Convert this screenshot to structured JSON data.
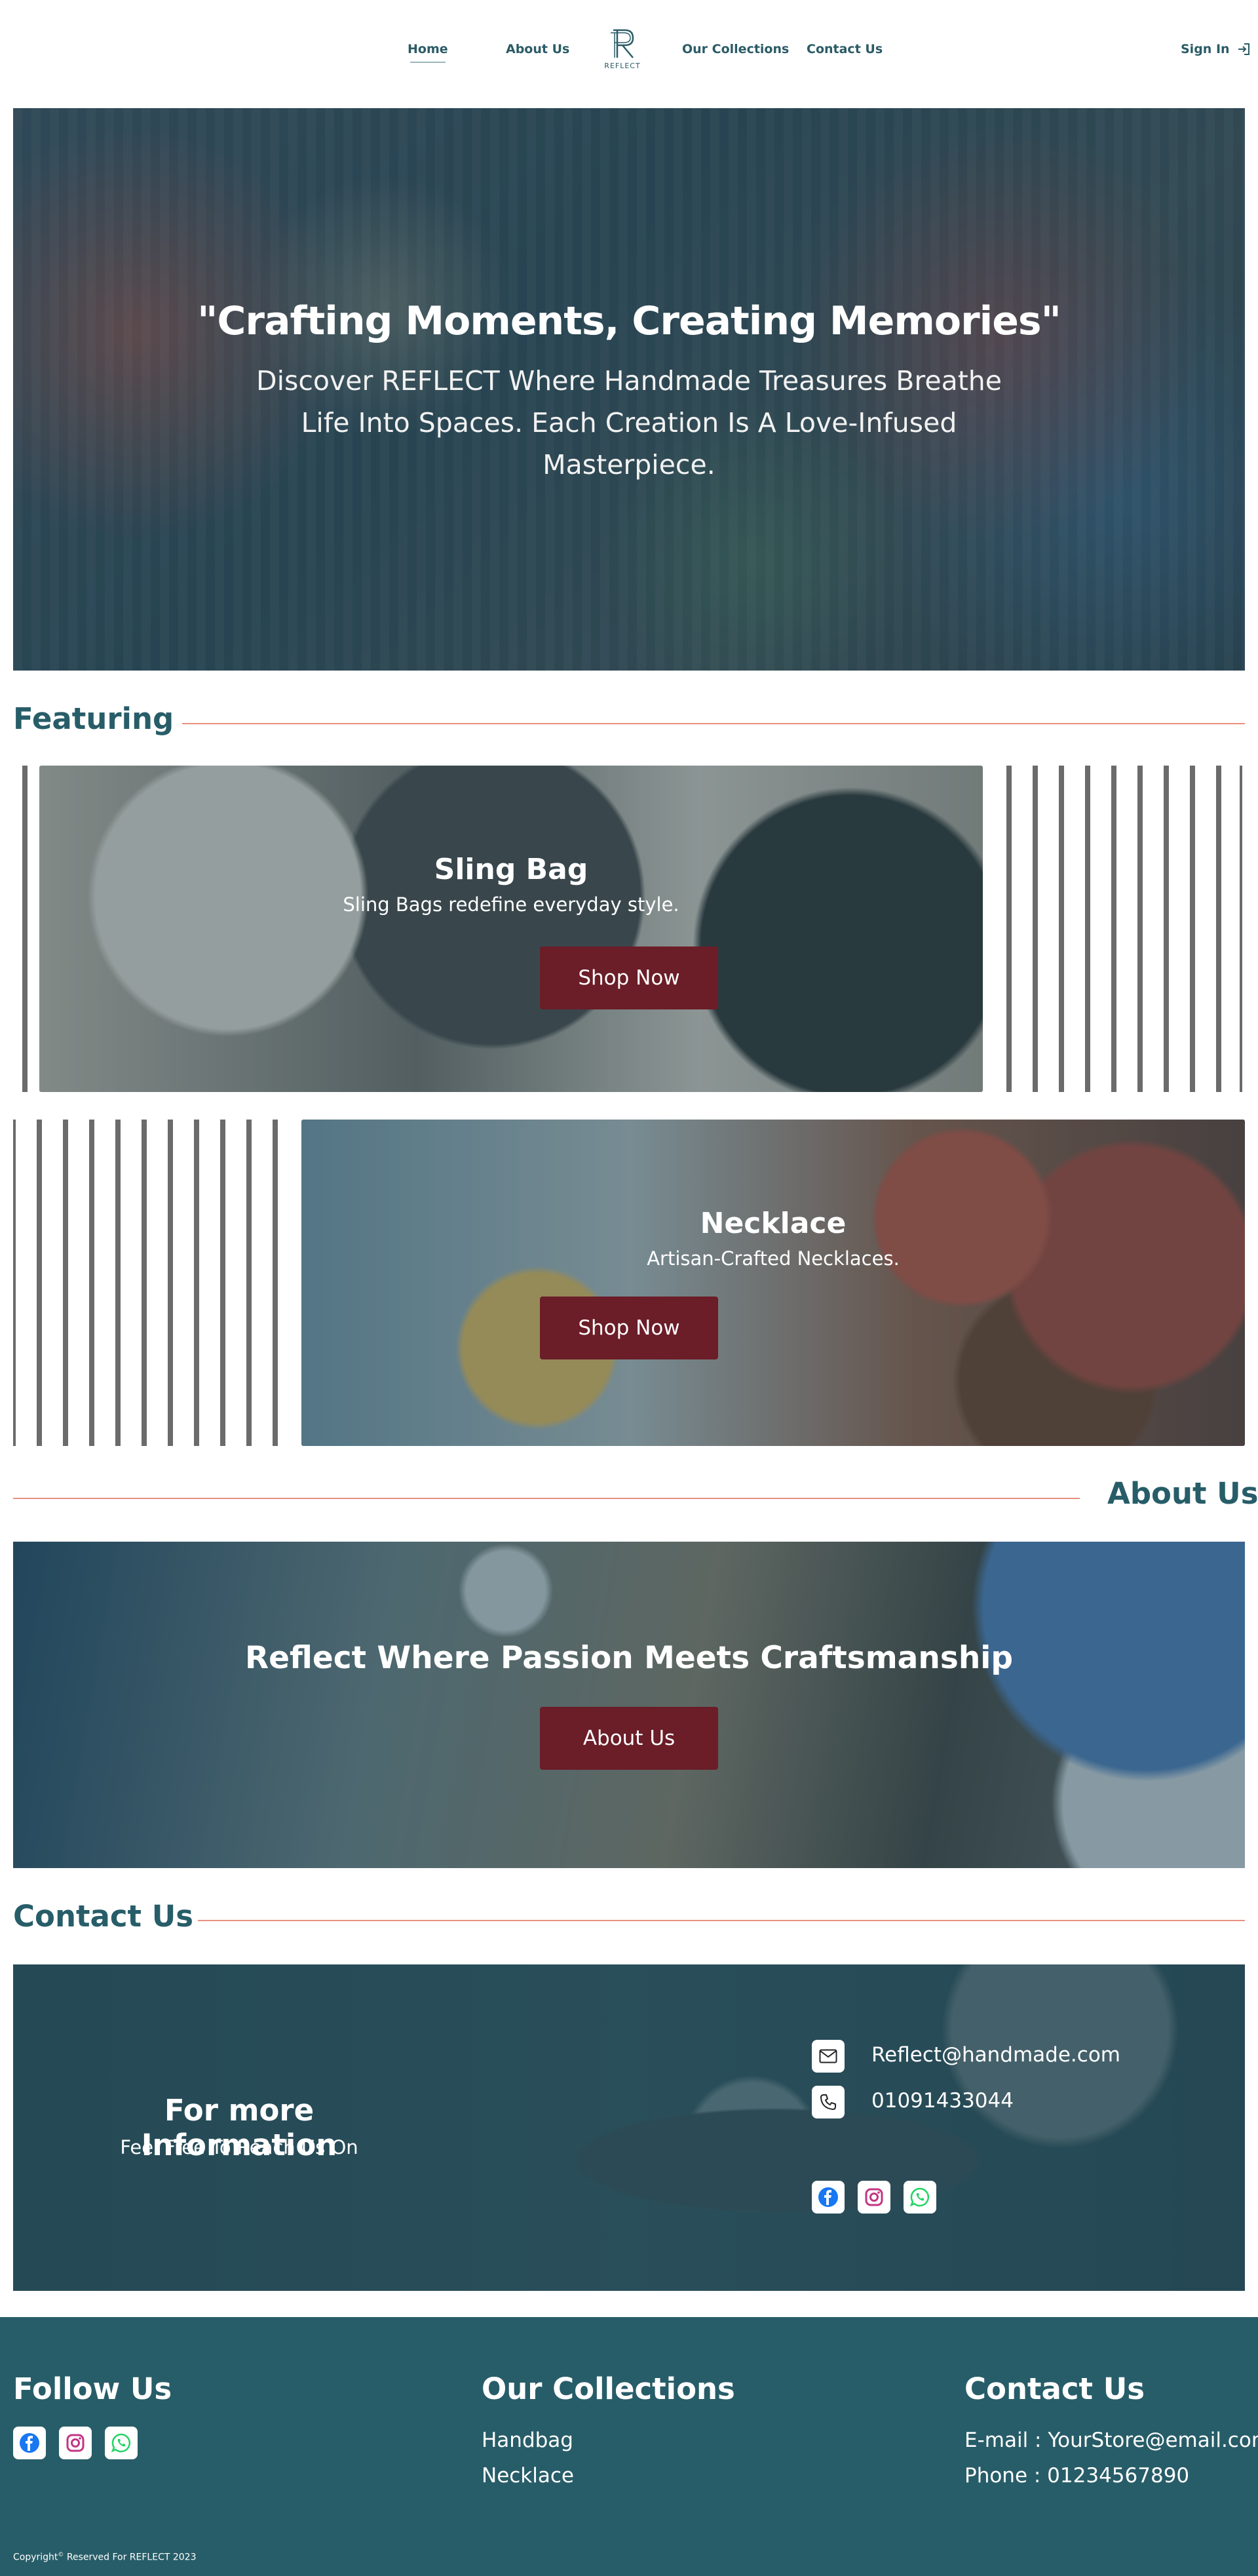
{
  "nav": {
    "home": "Home",
    "about": "About Us",
    "logo_text": "REFLECT",
    "collections": "Our Collections",
    "contact": "Contact Us",
    "sign_in": "Sign In"
  },
  "hero": {
    "title": "\"Crafting Moments, Creating Memories\"",
    "subtitle": "Discover REFLECT Where Handmade Treasures Breathe Life Into Spaces. Each Creation Is A Love-Infused Masterpiece."
  },
  "featuring": {
    "heading": "Featuring",
    "cards": [
      {
        "title": "Sling Bag",
        "subtitle": "Sling Bags redefine everyday style.",
        "button": "Shop Now"
      },
      {
        "title": "Necklace",
        "subtitle": "Artisan-Crafted Necklaces.",
        "button": "Shop Now"
      }
    ]
  },
  "about": {
    "heading": "About Us",
    "title": "Reflect Where Passion Meets Craftsmanship",
    "button": "About Us"
  },
  "contact": {
    "heading": "Contact Us",
    "info_title": "For more Information",
    "info_sub": "Feel Free To Reach Us On",
    "email": "Reflect@handmade.com",
    "phone": "01091433044"
  },
  "footer": {
    "follow_heading": "Follow Us",
    "collections_heading": "Our Collections",
    "collections": [
      "Handbag",
      "Necklace"
    ],
    "contact_heading": "Contact Us",
    "email": "E-mail : YourStore@email.com",
    "phone": "Phone : 01234567890",
    "copyright_pre": "Copyright",
    "copyright_sup": "©",
    "copyright_post": " Reserved For REFLECT 2023"
  },
  "colors": {
    "brand": "#275d68",
    "accent_line": "#e8907f",
    "button": "#6b1d28",
    "facebook": "#1877f2",
    "instagram": "#c13584",
    "whatsapp": "#25d366"
  },
  "icons": [
    "logo-icon",
    "sign-in-icon",
    "mail-icon",
    "phone-icon",
    "facebook-icon",
    "instagram-icon",
    "whatsapp-icon"
  ]
}
